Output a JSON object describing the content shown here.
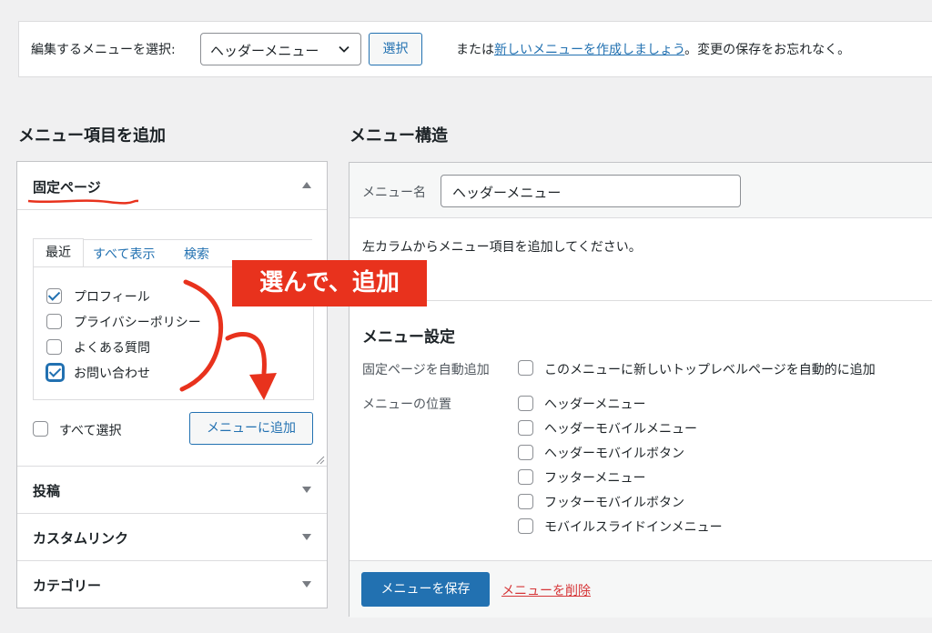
{
  "top": {
    "select_label": "編集するメニューを選択:",
    "selected_menu": "ヘッダーメニュー",
    "select_button": "選択",
    "or_text": "または",
    "create_link": "新しいメニューを作成しましょう",
    "tail_text": "。変更の保存をお忘れなく。"
  },
  "left": {
    "heading": "メニュー項目を追加",
    "pages": {
      "title": "固定ページ",
      "tabs": [
        "最近",
        "すべて表示",
        "検索"
      ],
      "items": [
        {
          "label": "プロフィール",
          "checked": true
        },
        {
          "label": "プライバシーポリシー",
          "checked": false
        },
        {
          "label": "よくある質問",
          "checked": false
        },
        {
          "label": "お問い合わせ",
          "checked": true
        }
      ],
      "select_all": "すべて選択",
      "add_button": "メニューに追加"
    },
    "sections": [
      "投稿",
      "カスタムリンク",
      "カテゴリー"
    ]
  },
  "right": {
    "heading": "メニュー構造",
    "name_label": "メニュー名",
    "name_value": "ヘッダーメニュー",
    "instruction": "左カラムからメニュー項目を追加してください。",
    "settings_title": "メニュー設定",
    "auto_add_label": "固定ページを自動追加",
    "auto_add_option": "このメニューに新しいトップレベルページを自動的に追加",
    "location_label": "メニューの位置",
    "locations": [
      "ヘッダーメニュー",
      "ヘッダーモバイルメニュー",
      "ヘッダーモバイルボタン",
      "フッターメニュー",
      "フッターモバイルボタン",
      "モバイルスライドインメニュー"
    ],
    "save_button": "メニューを保存",
    "delete_link": "メニューを削除"
  },
  "annotation": {
    "callout": "選んで、追加"
  },
  "colors": {
    "accent": "#2271b1",
    "danger": "#d63638",
    "annotation": "#e8321d"
  }
}
